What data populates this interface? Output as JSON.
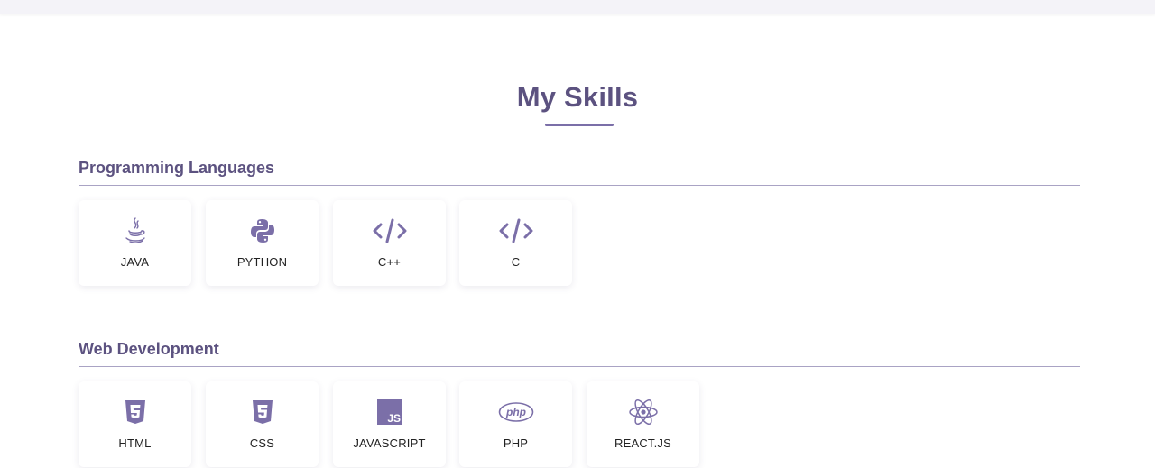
{
  "page": {
    "title": "My Skills"
  },
  "colors": {
    "accent": "#5c5280",
    "icon": "#7b6fa8",
    "rule": "#a9a3c4"
  },
  "sections": [
    {
      "heading": "Programming Languages",
      "skills": [
        {
          "label": "JAVA",
          "icon": "java-icon"
        },
        {
          "label": "PYTHON",
          "icon": "python-icon"
        },
        {
          "label": "C++",
          "icon": "code-icon"
        },
        {
          "label": "C",
          "icon": "code-icon"
        }
      ]
    },
    {
      "heading": "Web Development",
      "skills": [
        {
          "label": "HTML",
          "icon": "html5-icon"
        },
        {
          "label": "CSS",
          "icon": "css3-icon"
        },
        {
          "label": "JAVASCRIPT",
          "icon": "js-icon",
          "badge_text": "JS"
        },
        {
          "label": "PHP",
          "icon": "php-icon",
          "badge_text": "php"
        },
        {
          "label": "REACT.JS",
          "icon": "react-icon"
        }
      ]
    }
  ]
}
